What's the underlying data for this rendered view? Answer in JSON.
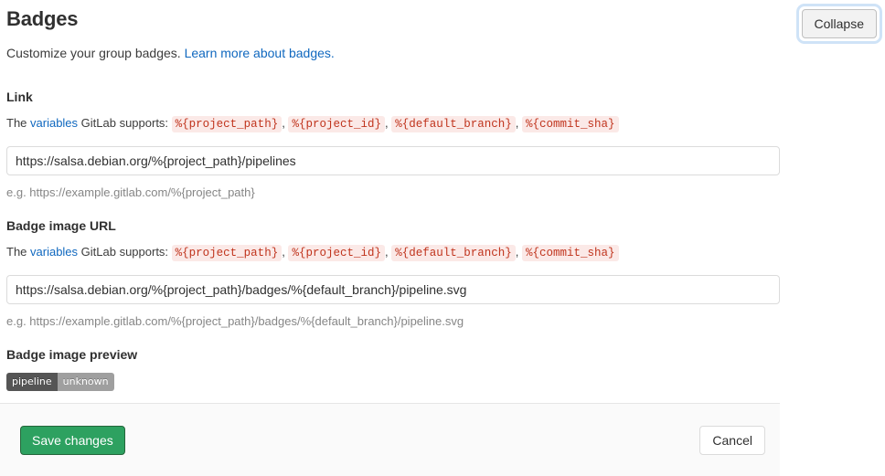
{
  "header": {
    "title": "Badges",
    "subtitle_text": "Customize your group badges.",
    "subtitle_link": "Learn more about badges.",
    "collapse_label": "Collapse"
  },
  "colors": {
    "link": "#1068bf",
    "code_text": "#c0341d",
    "code_bg": "#fbe9e7",
    "save_green": "#2da160",
    "focus_ring": "#cfe3f7",
    "badge_left": "#555555",
    "badge_right": "#9f9f9f"
  },
  "variables_line": {
    "prefix": "The ",
    "link": "variables",
    "suffix": " GitLab supports:",
    "tokens": [
      "%{project_path}",
      "%{project_id}",
      "%{default_branch}",
      "%{commit_sha}"
    ],
    "separator": ","
  },
  "link_field": {
    "label": "Link",
    "value": "https://salsa.debian.org/%{project_path}/pipelines",
    "placeholder": "https://example.gitlab.com/%{project_path}",
    "hint": "e.g. https://example.gitlab.com/%{project_path}"
  },
  "image_url_field": {
    "label": "Badge image URL",
    "value": "https://salsa.debian.org/%{project_path}/badges/%{default_branch}/pipeline.svg",
    "placeholder": "https://example.gitlab.com/%{project_path}/badges/%{default_branch}/pipeline.svg",
    "hint": "e.g. https://example.gitlab.com/%{project_path}/badges/%{default_branch}/pipeline.svg"
  },
  "preview": {
    "label": "Badge image preview",
    "badge_left": "pipeline",
    "badge_right": "unknown"
  },
  "footer": {
    "save_label": "Save changes",
    "cancel_label": "Cancel"
  }
}
